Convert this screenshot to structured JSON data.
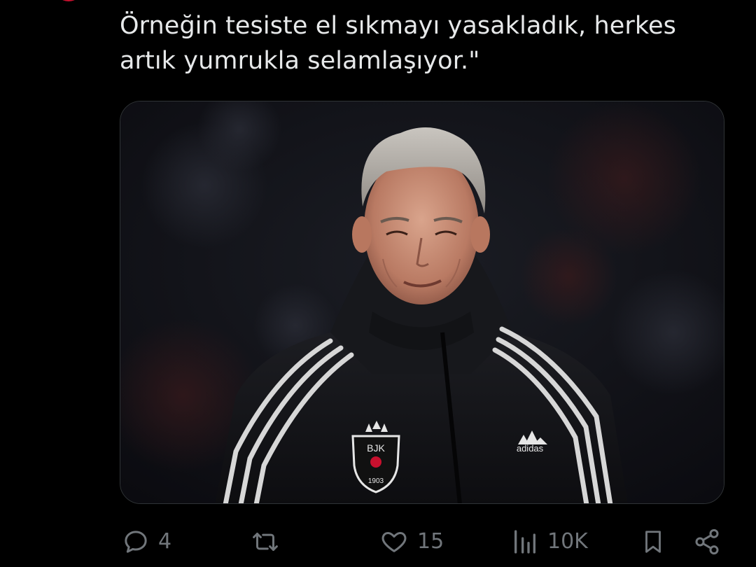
{
  "tweet": {
    "text_lines": [
      "Örneğin tesiste el sıkmayı yasakladık, herkes",
      "artık yumrukla selamlaşıyor.\""
    ]
  },
  "media": {
    "description": "photo",
    "badge_text": "BJK",
    "badge_year": "1903",
    "brand_text": "adidas"
  },
  "actions": {
    "reply": {
      "icon": "reply-icon",
      "count": "4"
    },
    "retweet": {
      "icon": "retweet-icon",
      "count": ""
    },
    "like": {
      "icon": "heart-icon",
      "count": "15"
    },
    "views": {
      "icon": "views-icon",
      "count": "10K"
    },
    "bookmark": {
      "icon": "bookmark-icon"
    },
    "share": {
      "icon": "share-icon"
    }
  },
  "colors": {
    "background": "#000000",
    "text": "#e7e9ea",
    "muted": "#71767b"
  }
}
